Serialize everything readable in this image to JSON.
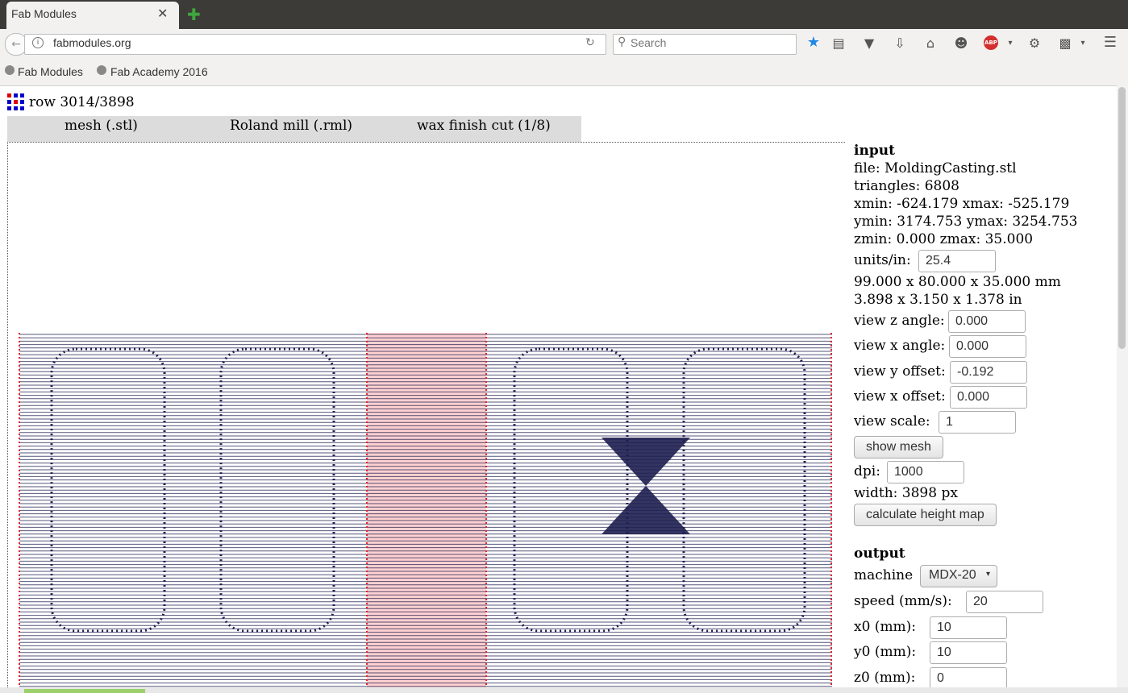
{
  "browser": {
    "tab_title": "Fab Modules",
    "tab_close": "✕",
    "new_tab": "✚",
    "url": "fabmodules.org",
    "search_placeholder": "Search",
    "bookmarks": [
      "Fab Modules",
      "Fab Academy 2016"
    ],
    "toolbar_icons": [
      "star-icon",
      "reading-list-icon",
      "pocket-icon",
      "download-icon",
      "home-icon",
      "emoji-icon",
      "adblock-icon",
      "menu-dropdown-icon",
      "extension-icon",
      "clipboard-icon",
      "dropdown-icon",
      "hamburger-icon"
    ],
    "adblock_label": "ABP"
  },
  "page": {
    "row_status": "row 3014/3898",
    "breadcrumbs": [
      "mesh (.stl)",
      "Roland mill (.rml)",
      "wax finish cut (1/8)"
    ]
  },
  "input": {
    "heading": "input",
    "file": "file: MoldingCasting.stl",
    "triangles": "triangles: 6808",
    "x_range": "xmin: -624.179 xmax: -525.179",
    "y_range": "ymin: 3174.753 ymax: 3254.753",
    "z_range": "zmin: 0.000 zmax: 35.000",
    "units_label": "units/in:",
    "units_value": "25.4",
    "size_mm": "99.000 x 80.000 x 35.000 mm",
    "size_in": "3.898 x 3.150 x 1.378 in",
    "view_z_label": "view z angle:",
    "view_z_value": "0.000",
    "view_x_label": "view x angle:",
    "view_x_value": "0.000",
    "view_y_offset_label": "view y offset:",
    "view_y_offset_value": "-0.192",
    "view_x_offset_label": "view x offset:",
    "view_x_offset_value": "0.000",
    "view_scale_label": "view scale:",
    "view_scale_value": "1",
    "show_mesh": "show mesh",
    "dpi_label": "dpi:",
    "dpi_value": "1000",
    "width": "width: 3898 px",
    "calc_button": "calculate height map"
  },
  "output": {
    "heading": "output",
    "machine_label": "machine",
    "machine_value": "MDX-20",
    "speed_label": "speed (mm/s):",
    "speed_value": "20",
    "x0_label": "x0 (mm):",
    "x0_value": "10",
    "y0_label": "y0 (mm):",
    "y0_value": "10",
    "z0_label": "z0 (mm):",
    "z0_value": "0"
  },
  "colors": {
    "toolpath": "#1e1e50",
    "highlight": "#ff9a9a",
    "edge_marker": "#e8212a"
  }
}
